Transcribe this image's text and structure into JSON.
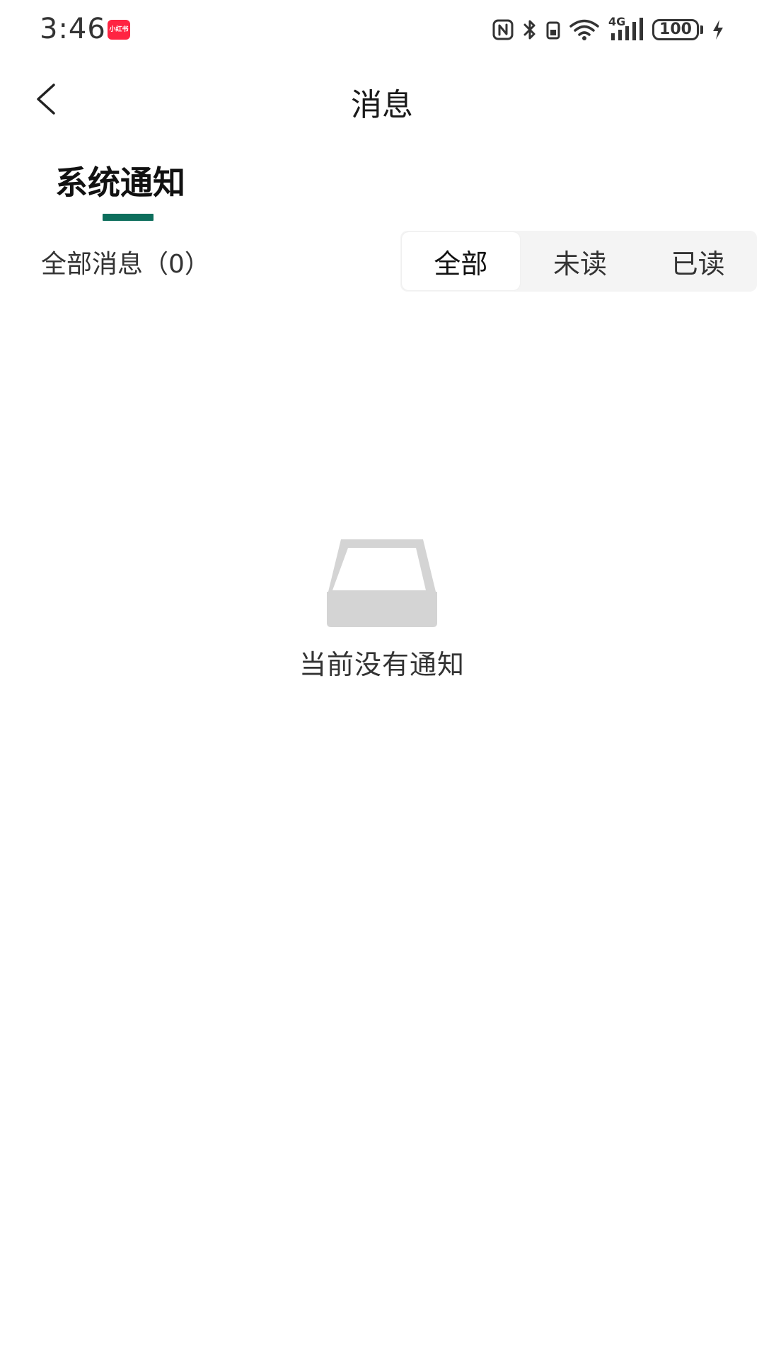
{
  "status_bar": {
    "time": "3:46",
    "app_badge": "小红书",
    "network": "4G",
    "battery": "100",
    "icons": [
      "nfc-icon",
      "bluetooth-icon",
      "vibrate-icon",
      "wifi-icon",
      "signal-icon",
      "battery-icon",
      "charging-icon"
    ]
  },
  "header": {
    "title": "消息",
    "back_icon": "back-arrow-icon"
  },
  "tabs": {
    "system_notice": "系统通知",
    "indicator_color": "#0d6e5c"
  },
  "filter": {
    "count_label": "全部消息（0）",
    "options": [
      "全部",
      "未读",
      "已读"
    ],
    "selected": "全部"
  },
  "empty": {
    "text": "当前没有通知",
    "icon": "inbox-tray-icon"
  }
}
